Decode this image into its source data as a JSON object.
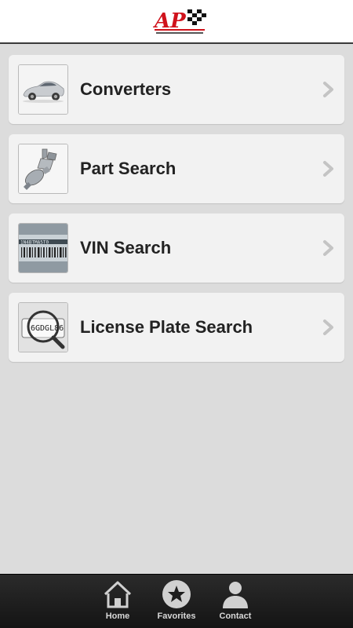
{
  "header": {
    "logo_alt": "AP Emissions Technologies"
  },
  "menu": {
    "items": [
      {
        "label": "Converters",
        "icon": "car-icon"
      },
      {
        "label": "Part Search",
        "icon": "catalytic-converter-icon"
      },
      {
        "label": "VIN Search",
        "icon": "vin-barcode-icon"
      },
      {
        "label": "License Plate Search",
        "icon": "license-plate-magnifier-icon"
      }
    ]
  },
  "tabbar": {
    "tabs": [
      {
        "label": "Home",
        "icon": "home-icon"
      },
      {
        "label": "Favorites",
        "icon": "star-icon"
      },
      {
        "label": "Contact",
        "icon": "person-icon"
      }
    ]
  },
  "colors": {
    "background": "#dcdcdc",
    "item_background": "#f2f2f2",
    "logo_red": "#d0121b",
    "tabbar": "#1e1e1e"
  }
}
